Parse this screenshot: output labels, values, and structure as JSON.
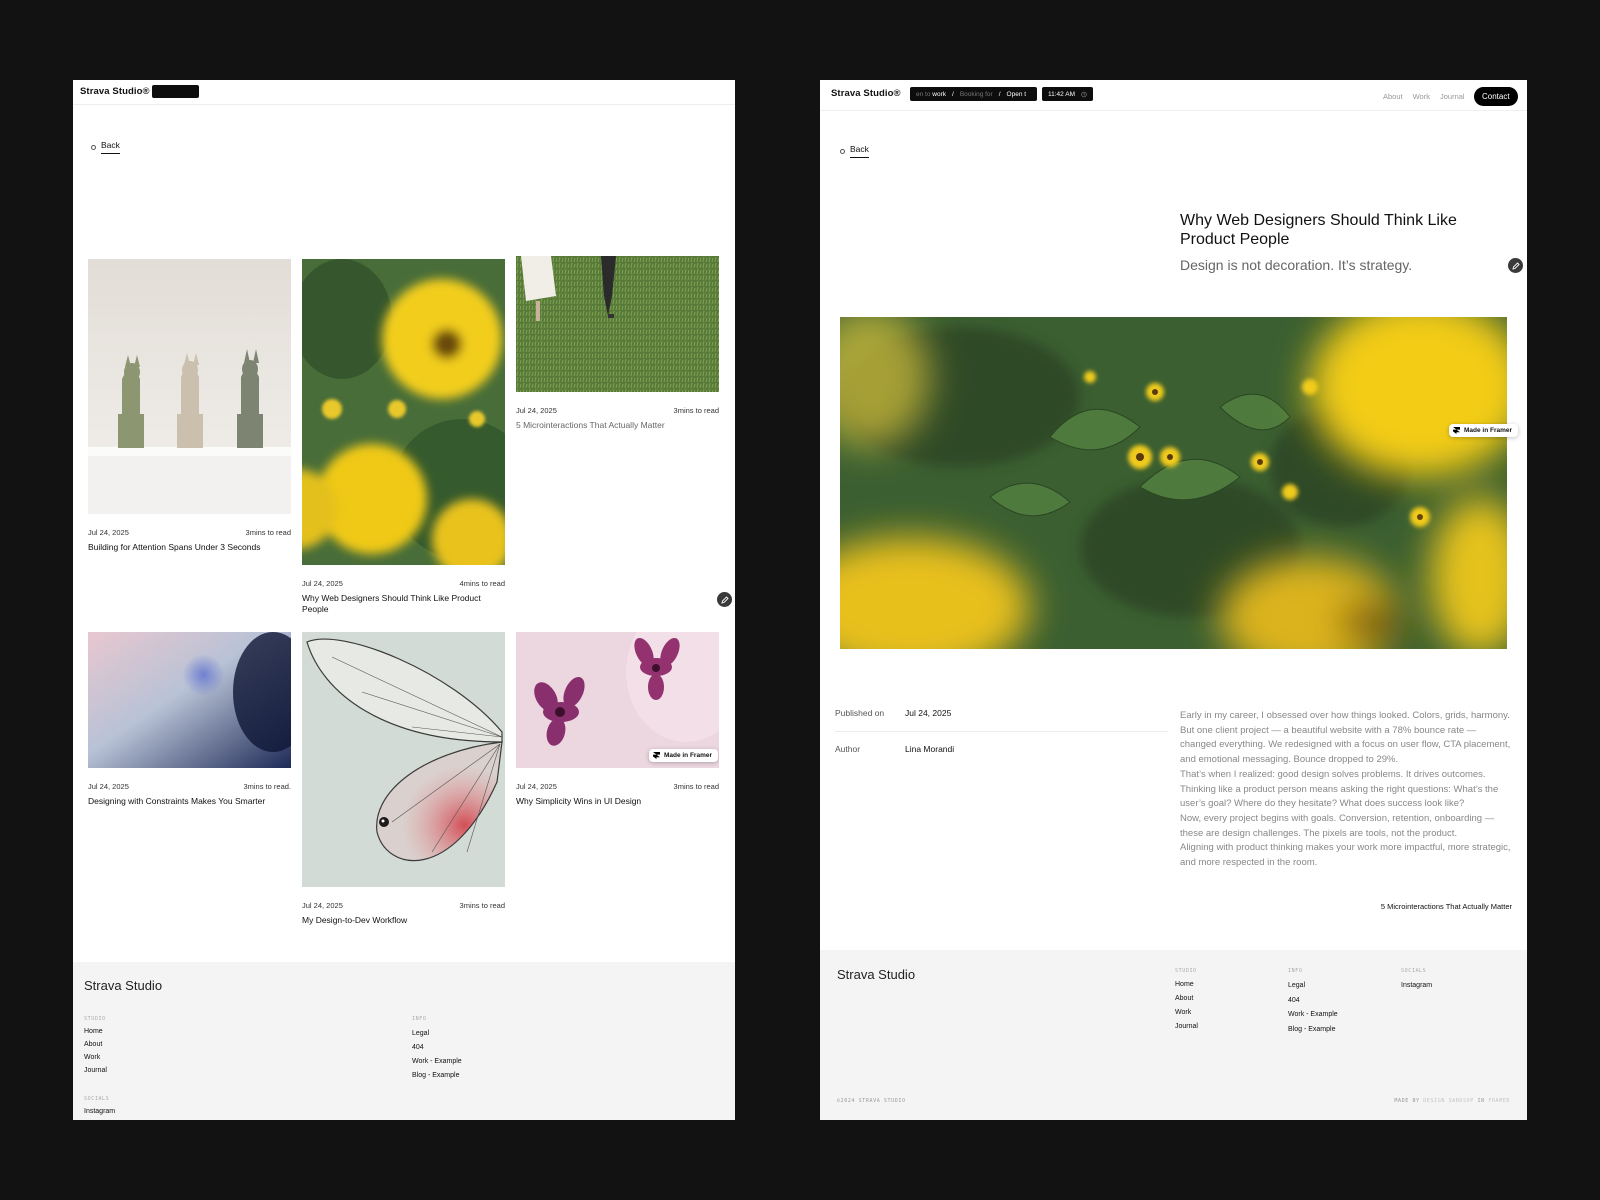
{
  "brand": "Strava Studio®",
  "left": {
    "back_label": "Back",
    "posts": [
      {
        "date": "Jul 24, 2025",
        "read": "3mins to read",
        "title": "Building for Attention Spans Under 3 Seconds"
      },
      {
        "date": "Jul 24, 2025",
        "read": "4mins to read",
        "title": "Why Web Designers Should Think Like Product People"
      },
      {
        "date": "Jul 24, 2025",
        "read": "3mins to read",
        "title": "5 Microinteractions That Actually Matter"
      },
      {
        "date": "Jul 24, 2025",
        "read": "3mins to read.",
        "title": "Designing with Constraints Makes You Smarter"
      },
      {
        "date": "Jul 24, 2025",
        "read": "3mins to read",
        "title": "My Design-to-Dev Workflow"
      },
      {
        "date": "Jul 24, 2025",
        "read": "3mins to read",
        "title": "Why Simplicity Wins in UI Design"
      }
    ],
    "badge": "Made in Framer"
  },
  "right": {
    "ticker": {
      "a": "en to",
      "b": "work",
      "c": "Booking for",
      "d": "Open t"
    },
    "time": "11:42 AM",
    "nav": [
      "About",
      "Work",
      "Journal"
    ],
    "contact": "Contact",
    "back_label": "Back",
    "title": "Why Web Designers Should Think Like Product People",
    "subtitle": "Design is not decoration. It’s strategy.",
    "badge": "Made in Framer",
    "published_label": "Published on",
    "published_value": "Jul 24, 2025",
    "author_label": "Author",
    "author_value": "Lina Morandi",
    "paragraphs": [
      "Early in my career, I obsessed over how things looked. Colors, grids, harmony. But one client project — a beautiful website with a 78% bounce rate — changed everything. We redesigned with a focus on user flow, CTA placement, and emotional messaging. Bounce dropped to 29%.",
      "That’s when I realized: good design solves problems. It drives outcomes.",
      "Thinking like a product person means asking the right questions: What’s the user’s goal? Where do they hesitate? What does success look like?",
      "Now, every project begins with goals. Conversion, retention, onboarding — these are design challenges. The pixels are tools, not the product.",
      "Aligning with product thinking makes your work more impactful, more strategic, and more respected in the room."
    ],
    "next": "5 Microinteractions That Actually Matter"
  },
  "footer": {
    "title": "Strava Studio",
    "studio_head": "STUDIO",
    "studio": [
      "Home",
      "About",
      "Work",
      "Journal"
    ],
    "info_head": "INFO",
    "info": [
      "Legal",
      "404",
      "Work - Example",
      "Blog - Example"
    ],
    "socials_head": "SOCIALS",
    "socials": [
      "Instagram"
    ],
    "copyright": "©2024 STRAVA STUDIO",
    "made_by": "MADE BY",
    "made_by_name": "DESIGN SANDSOP",
    "made_in": "IN",
    "made_in_name": "FRAMER"
  },
  "colors": {
    "page_bg": "#121212",
    "footer_bg": "#f4f4f4",
    "sunflower": "#e6c21a",
    "leaf": "#3e6a34"
  }
}
